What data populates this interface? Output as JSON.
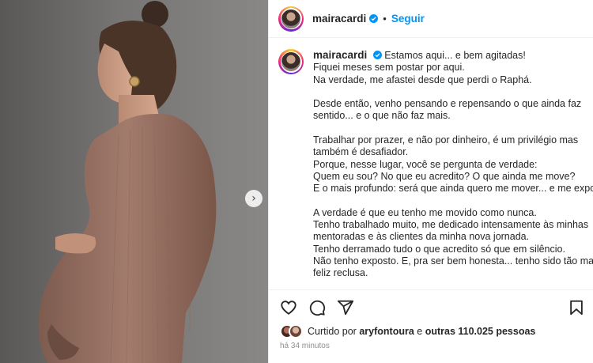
{
  "post": {
    "username": "mairacardi",
    "verified": true,
    "follow_label": "Seguir",
    "separator": "•"
  },
  "media": {
    "next_icon": "chevron-right-icon",
    "next_glyph": "›"
  },
  "caption": {
    "username": "mairacardi",
    "paragraphs": [
      [
        "Estamos aqui... e bem agitadas!",
        "Fiquei meses sem postar por aqui.",
        "Na verdade, me afastei desde que perdi o Raphá."
      ],
      [
        "Desde então, venho pensando e repensando o que ainda faz",
        "sentido... e o que não faz mais."
      ],
      [
        "Trabalhar por prazer, e não por dinheiro, é um privilégio mas",
        "também é desafiador.",
        "Porque, nesse lugar, você se pergunta de verdade:",
        "Quem eu sou? No que eu acredito? O que ainda me move?",
        "E o mais profundo: será que ainda quero me mover... e me expor?"
      ],
      [
        "A verdade é que eu tenho me movido como nunca.",
        "Tenho trabalhado muito, me dedicado intensamente às minhas",
        "mentoradas e às clientes da minha nova jornada.",
        "Tenho derramado tudo o que acredito só que em silêncio.",
        "Não tenho exposto. E, pra ser bem honesta... tenho sido tão mais",
        "feliz reclusa."
      ]
    ]
  },
  "actions": {
    "icons": [
      "heart-icon",
      "comment-icon",
      "share-icon",
      "bookmark-icon"
    ]
  },
  "likes": {
    "prefix": "Curtido por",
    "user": "aryfontoura",
    "middle": "e",
    "others": "outras 110.025 pessoas"
  },
  "timestamp": "há 34 minutos",
  "colors": {
    "accent": "#0095f6",
    "dress": "#9c7566",
    "text": "#262626",
    "muted": "#8e8e8e"
  }
}
